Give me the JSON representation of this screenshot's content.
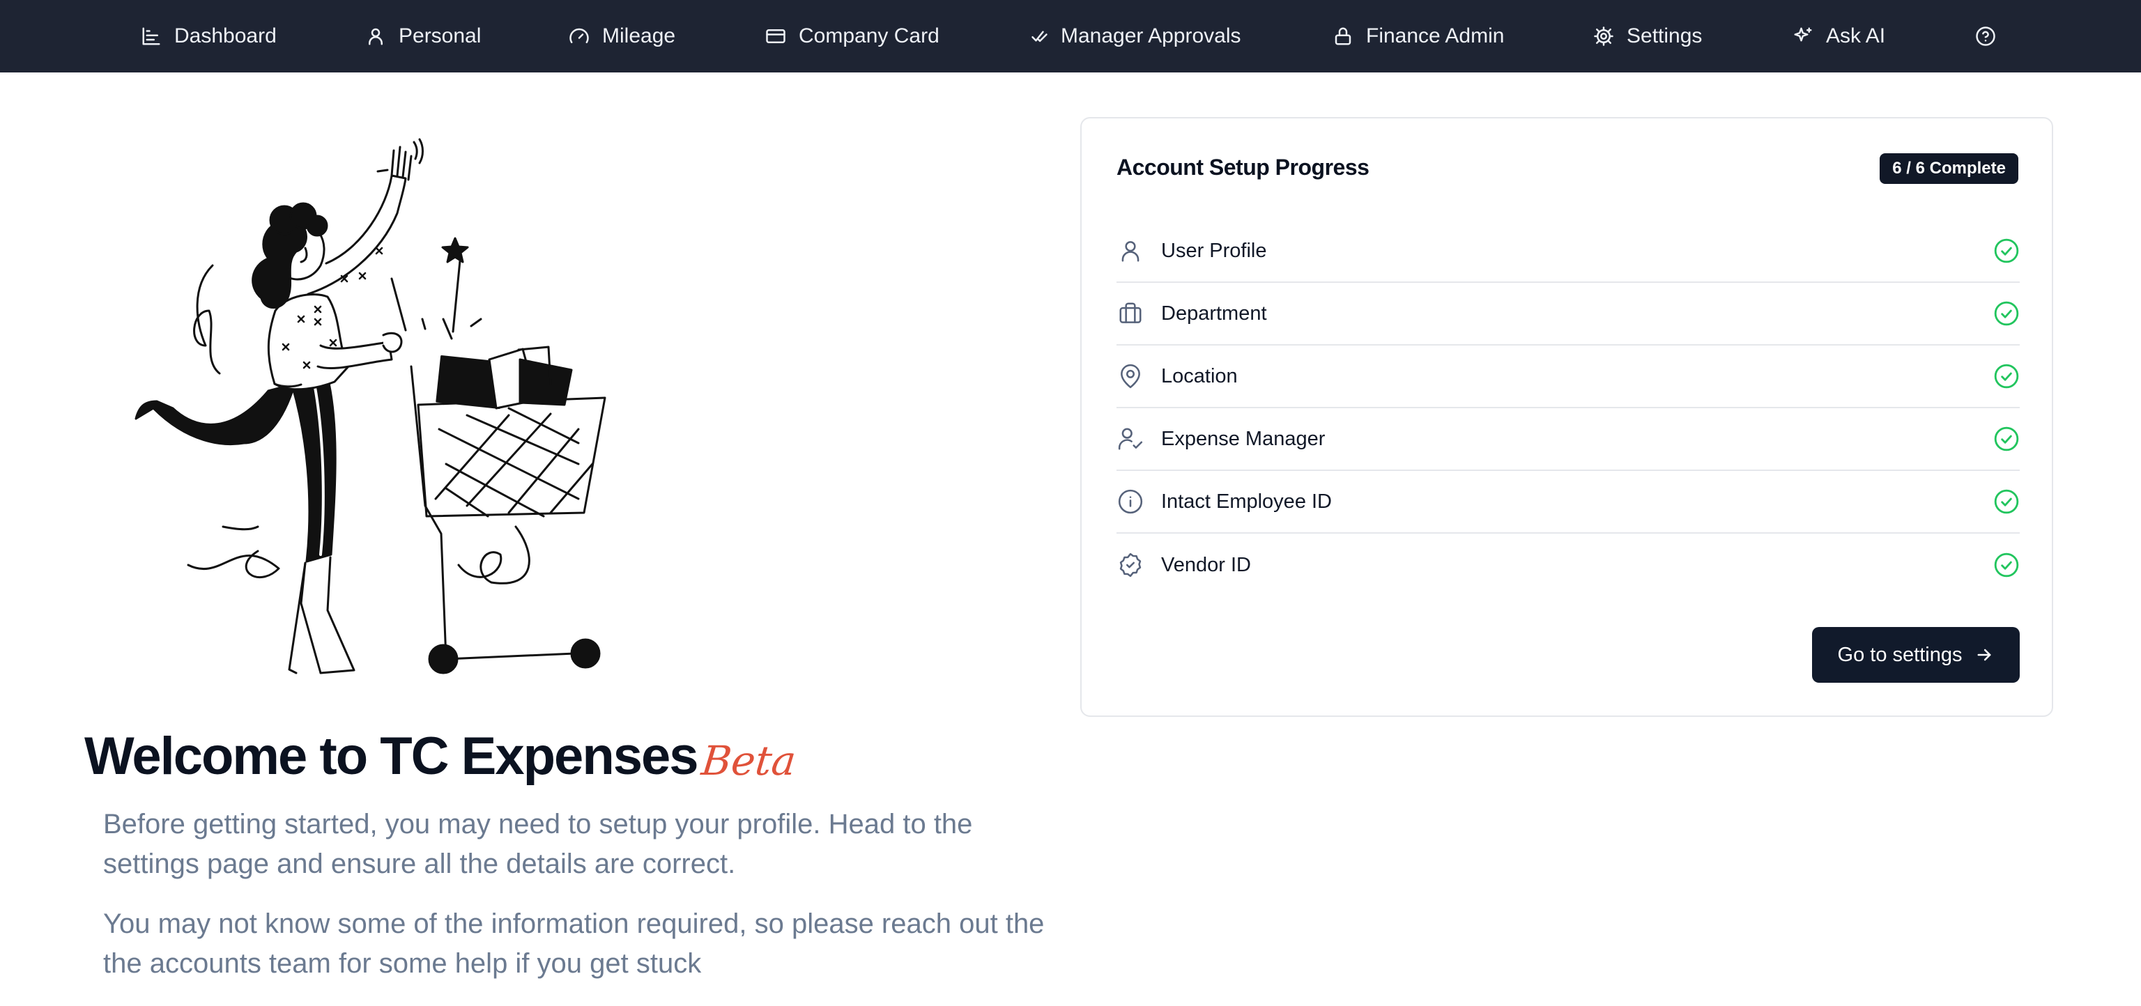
{
  "nav": {
    "items": [
      {
        "label": "Dashboard",
        "icon": "bar-chart-icon"
      },
      {
        "label": "Personal",
        "icon": "user-icon"
      },
      {
        "label": "Mileage",
        "icon": "gauge-icon"
      },
      {
        "label": "Company Card",
        "icon": "credit-card-icon"
      },
      {
        "label": "Manager Approvals",
        "icon": "double-check-icon"
      },
      {
        "label": "Finance Admin",
        "icon": "lock-icon"
      },
      {
        "label": "Settings",
        "icon": "gear-icon"
      },
      {
        "label": "Ask AI",
        "icon": "sparkles-icon"
      }
    ],
    "help_icon": "help-circle-icon"
  },
  "welcome": {
    "title": "Welcome to TC Expenses",
    "badge": "Beta",
    "paragraph_1": "Before getting started, you may need to setup your profile. Head to the settings page and ensure all the details are correct.",
    "paragraph_2": "You may not know some of the information required, so please reach out the the accounts team for some help if you get stuck"
  },
  "setup": {
    "title": "Account Setup Progress",
    "progress": "6 / 6 Complete",
    "completed": 6,
    "total": 6,
    "steps": [
      {
        "label": "User Profile",
        "icon": "user-icon",
        "complete": true
      },
      {
        "label": "Department",
        "icon": "briefcase-icon",
        "complete": true
      },
      {
        "label": "Location",
        "icon": "map-pin-icon",
        "complete": true
      },
      {
        "label": "Expense Manager",
        "icon": "user-check-icon",
        "complete": true
      },
      {
        "label": "Intact Employee ID",
        "icon": "info-icon",
        "complete": true
      },
      {
        "label": "Vendor ID",
        "icon": "badge-check-icon",
        "complete": true
      }
    ],
    "button_label": "Go to settings"
  },
  "colors": {
    "nav_background": "#1e2433",
    "beta_accent": "#e0523a",
    "complete_check": "#22c55e",
    "button_background": "#111a2b"
  }
}
